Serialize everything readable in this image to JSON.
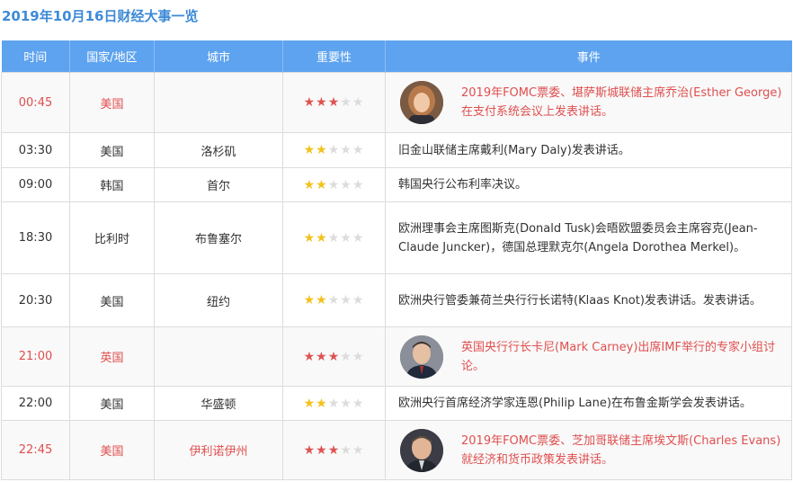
{
  "page": {
    "title": "2019年10月16日财经大事一览"
  },
  "columns": {
    "time": "时间",
    "country": "国家/地区",
    "city": "城市",
    "importance": "重要性",
    "event": "事件"
  },
  "colors": {
    "header_bg": "#5ea3ef",
    "title": "#3d8ad8",
    "important_text": "#e04f4f",
    "star_high": "#e05252",
    "star_mid": "#f2c21c",
    "star_off": "#dcdcdc"
  },
  "rows": [
    {
      "time": "00:45",
      "country": "美国",
      "city": "",
      "stars": 3,
      "max_stars": 5,
      "important": true,
      "avatar": "esther-george-avatar",
      "event": "2019年FOMC票委、堪萨斯城联储主席乔治(Esther George)在支付系统会议上发表讲话。"
    },
    {
      "time": "03:30",
      "country": "美国",
      "city": "洛杉矶",
      "stars": 2,
      "max_stars": 5,
      "important": false,
      "avatar": "",
      "event": "旧金山联储主席戴利(Mary Daly)发表讲话。"
    },
    {
      "time": "09:00",
      "country": "韩国",
      "city": "首尔",
      "stars": 2,
      "max_stars": 5,
      "important": false,
      "avatar": "",
      "event": "韩国央行公布利率决议。"
    },
    {
      "time": "18:30",
      "country": "比利时",
      "city": "布鲁塞尔",
      "stars": 2,
      "max_stars": 5,
      "important": false,
      "avatar": "",
      "event": "欧洲理事会主席图斯克(Donald Tusk)会晤欧盟委员会主席容克(Jean-Claude Juncker)，德国总理默克尔(Angela Dorothea Merkel)。"
    },
    {
      "time": "20:30",
      "country": "美国",
      "city": "纽约",
      "stars": 2,
      "max_stars": 5,
      "important": false,
      "avatar": "",
      "event": "欧洲央行管委兼荷兰央行行长诺特(Klaas Knot)发表讲话。发表讲话。"
    },
    {
      "time": "21:00",
      "country": "英国",
      "city": "",
      "stars": 3,
      "max_stars": 5,
      "important": true,
      "avatar": "mark-carney-avatar",
      "event": "英国央行行长卡尼(Mark Carney)出席IMF举行的专家小组讨论。"
    },
    {
      "time": "22:00",
      "country": "美国",
      "city": "华盛顿",
      "stars": 2,
      "max_stars": 5,
      "important": false,
      "avatar": "",
      "event": "欧洲央行首席经济学家连恩(Philip Lane)在布鲁金斯学会发表讲话。"
    },
    {
      "time": "22:45",
      "country": "美国",
      "city": "伊利诺伊州",
      "stars": 3,
      "max_stars": 5,
      "important": true,
      "avatar": "charles-evans-avatar",
      "event": "2019年FOMC票委、芝加哥联储主席埃文斯(Charles Evans)就经济和货币政策发表讲话。"
    }
  ]
}
